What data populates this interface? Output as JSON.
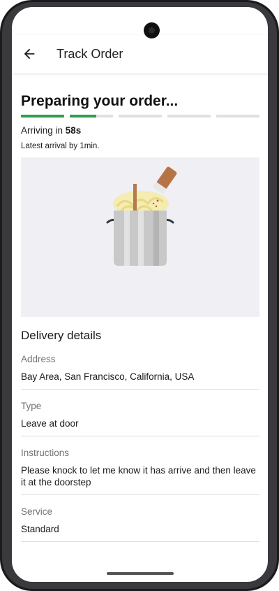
{
  "header": {
    "title": "Track Order",
    "back_icon": "arrow-left-icon"
  },
  "status": {
    "title": "Preparing your order...",
    "arriving_prefix": "Arriving in ",
    "arriving_time": "58s",
    "latest_arrival": "Latest arrival by 1min.",
    "progress": [
      1.0,
      0.62,
      0.0,
      0.0,
      0.0
    ],
    "progress_color": "#2e9e4f"
  },
  "illustration": {
    "icon": "cooking-pot-icon"
  },
  "delivery": {
    "title": "Delivery details",
    "items": [
      {
        "label": "Address",
        "value": "Bay Area, San Francisco, California, USA"
      },
      {
        "label": "Type",
        "value": "Leave at door"
      },
      {
        "label": "Instructions",
        "value": "Please knock to let me know it has arrive and then leave it at the doorstep"
      },
      {
        "label": "Service",
        "value": "Standard"
      }
    ]
  }
}
